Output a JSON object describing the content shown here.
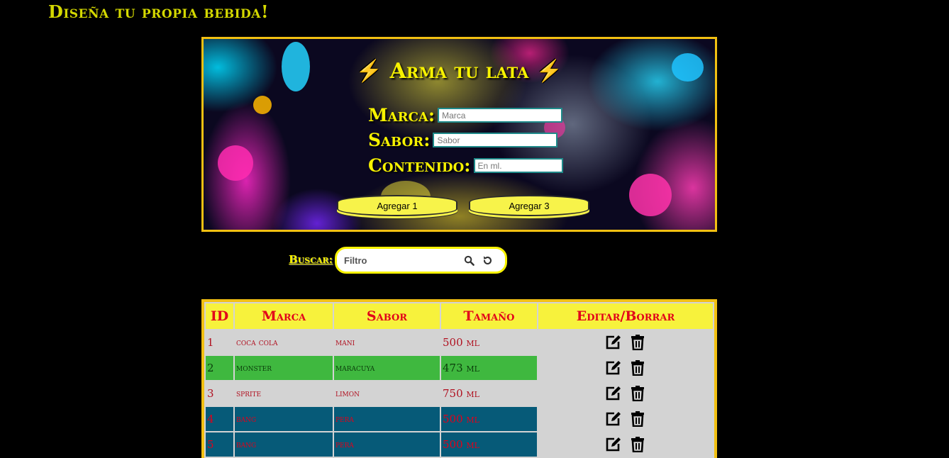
{
  "header": {
    "title": "Diseña tu propia bebida!"
  },
  "form": {
    "title": "Arma tu lata",
    "marca_label": "Marca:",
    "marca_placeholder": "Marca",
    "sabor_label": "Sabor:",
    "sabor_placeholder": "Sabor",
    "contenido_label": "Contenido:",
    "contenido_placeholder": "En ml.",
    "add1_label": "Agregar 1",
    "add3_label": "Agregar 3"
  },
  "search": {
    "label": "Buscar:",
    "placeholder": "Filtro"
  },
  "table": {
    "headers": [
      "ID",
      "Marca",
      "Sabor",
      "Tamaño",
      "Editar/Borrar"
    ],
    "rows": [
      {
        "id": "1",
        "marca": "coca cola",
        "sabor": "mani",
        "tamano": "500 ml"
      },
      {
        "id": "2",
        "marca": "monster",
        "sabor": "maracuya",
        "tamano": "473 ml"
      },
      {
        "id": "3",
        "marca": "sprite",
        "sabor": "limon",
        "tamano": "750 ml"
      },
      {
        "id": "4",
        "marca": "bang",
        "sabor": "pera",
        "tamano": "500 ml"
      },
      {
        "id": "5",
        "marca": "bang",
        "sabor": "pera",
        "tamano": "500 ml"
      }
    ]
  },
  "icons": {
    "bolt": "lightning-icon",
    "search": "search-icon",
    "reset": "reset-icon",
    "edit": "edit-icon",
    "delete": "trash-icon"
  },
  "colors": {
    "accent_yellow": "#f7f200",
    "border_gold": "#f2c012",
    "header_red": "#e2001a",
    "row_green": "#3fb83f",
    "row_teal": "#065a78"
  }
}
